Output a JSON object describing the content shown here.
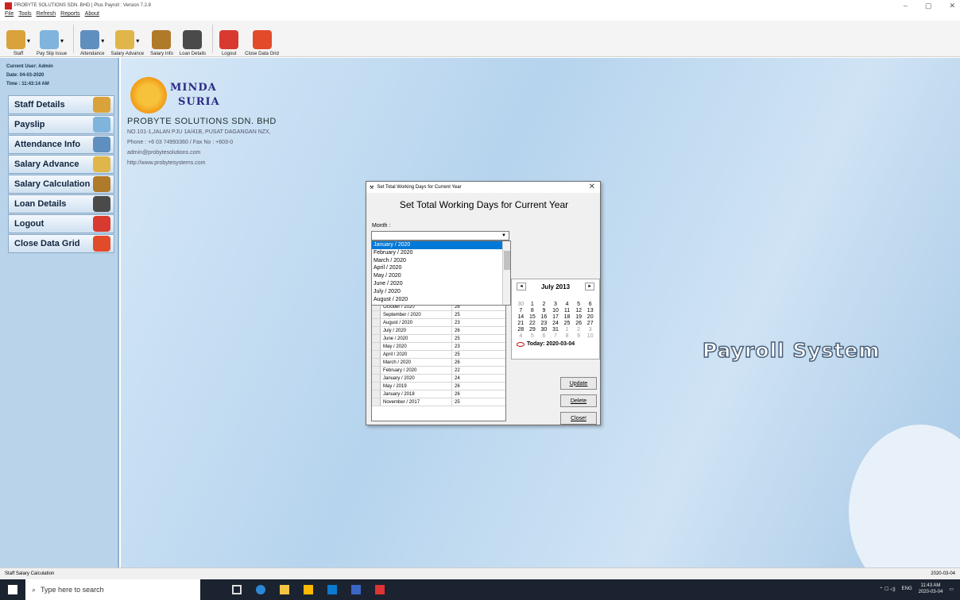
{
  "window": {
    "title": "PROBYTE SOLUTIONS SDN. BHD | Plus Payroll : Version 7.2.8",
    "controls": [
      "–",
      "▢",
      "✕"
    ]
  },
  "menu": [
    "File",
    "Tools",
    "Refresh",
    "Reports",
    "About"
  ],
  "toolbar": [
    {
      "label": "Staff",
      "icon": "staff-icon",
      "color": "#d9a23a",
      "dropdown": true
    },
    {
      "label": "Pay Slip Issue",
      "icon": "payslip-icon",
      "color": "#7fb4dc",
      "dropdown": true
    },
    {
      "label": "Attendance",
      "icon": "calendar-icon",
      "color": "#5f8fbf",
      "dropdown": true
    },
    {
      "label": "Salary Advance",
      "icon": "money-icon",
      "color": "#e0b64a",
      "dropdown": true
    },
    {
      "label": "Salary Info",
      "icon": "moneybag-icon",
      "color": "#b07a2b",
      "dropdown": false
    },
    {
      "label": "Loan Details",
      "icon": "loan-icon",
      "color": "#4a4a4a",
      "dropdown": false
    },
    {
      "label": "Logout",
      "icon": "power-icon",
      "color": "#d83a2f",
      "dropdown": false
    },
    {
      "label": "Close Data Grid",
      "icon": "close-icon",
      "color": "#e24b2a",
      "dropdown": false
    }
  ],
  "sidebar": {
    "user": "Current User: Admin",
    "date": "Date: 04-03-2020",
    "time": "Time : 11:43:14 AM",
    "items": [
      {
        "label": "Staff Details",
        "icon": "staff-icon",
        "color": "#d9a23a"
      },
      {
        "label": "Payslip",
        "icon": "payslip-icon",
        "color": "#7fb4dc"
      },
      {
        "label": "Attendance Info",
        "icon": "calendar-icon",
        "color": "#5f8fbf"
      },
      {
        "label": "Salary Advance",
        "icon": "money-icon",
        "color": "#e0b64a"
      },
      {
        "label": "Salary Calculation",
        "icon": "moneybag-icon",
        "color": "#b07a2b"
      },
      {
        "label": "Loan Details",
        "icon": "loan-icon",
        "color": "#4a4a4a"
      },
      {
        "label": "Logout",
        "icon": "power-icon",
        "color": "#d83a2f"
      },
      {
        "label": "Close Data Grid",
        "icon": "close-icon",
        "color": "#e24b2a"
      }
    ]
  },
  "logo": {
    "line1": "MINDA",
    "line2": "SURIA"
  },
  "company": {
    "name": "PROBYTE SOLUTIONS SDN. BHD",
    "address": "NO.101-1,JALAN PJU 1A/41B, PUSAT DAGANGAN NZX,",
    "phone": "Phone : +6 03 74993360 / Fax No : +603-0",
    "email": "admin@probytesolutions.com",
    "web": "http://www.probytesystems.com"
  },
  "brand_title": "Payroll System",
  "dialog": {
    "title": "Set Total Working Days for Current Year",
    "heading": "Set Total Working Days for Current Year",
    "month_label": "Month :",
    "month_value": "",
    "dropdown_options": [
      "January / 2020",
      "February / 2020",
      "March / 2020",
      "April / 2020",
      "May / 2020",
      "June / 2020",
      "July / 2020",
      "August / 2020"
    ],
    "selected_option": "January / 2020",
    "grid_rows": [
      {
        "month": "October / 2020",
        "days": "26"
      },
      {
        "month": "September / 2020",
        "days": "25"
      },
      {
        "month": "August / 2020",
        "days": "23"
      },
      {
        "month": "July / 2020",
        "days": "26"
      },
      {
        "month": "June / 2020",
        "days": "25"
      },
      {
        "month": "May / 2020",
        "days": "23"
      },
      {
        "month": "April / 2020",
        "days": "25"
      },
      {
        "month": "March / 2020",
        "days": "26"
      },
      {
        "month": "February / 2020",
        "days": "22"
      },
      {
        "month": "January / 2020",
        "days": "24"
      },
      {
        "month": "May / 2019",
        "days": "26"
      },
      {
        "month": "January / 2018",
        "days": "26"
      },
      {
        "month": "November / 2017",
        "days": "25"
      }
    ],
    "calendar": {
      "month": "July 2013",
      "prev": "◂",
      "next": "▸",
      "days": [
        "30",
        "1",
        "2",
        "3",
        "4",
        "5",
        "6",
        "7",
        "8",
        "9",
        "10",
        "11",
        "12",
        "13",
        "14",
        "15",
        "16",
        "17",
        "18",
        "19",
        "20",
        "21",
        "22",
        "23",
        "24",
        "25",
        "26",
        "27",
        "28",
        "29",
        "30",
        "31",
        "1",
        "2",
        "3",
        "4",
        "5",
        "6",
        "7",
        "8",
        "9",
        "10"
      ],
      "today": "Today: 2020-03-04"
    },
    "buttons": {
      "update": "Update",
      "delete": "Delete",
      "close": "Close!"
    }
  },
  "status": {
    "left": "Staff Salary Calculation",
    "right": "2020-03-04"
  },
  "taskbar": {
    "search_placeholder": "Type here to search",
    "tray_lang": "ENG",
    "time": "11:43 AM",
    "date": "2020-03-04"
  }
}
